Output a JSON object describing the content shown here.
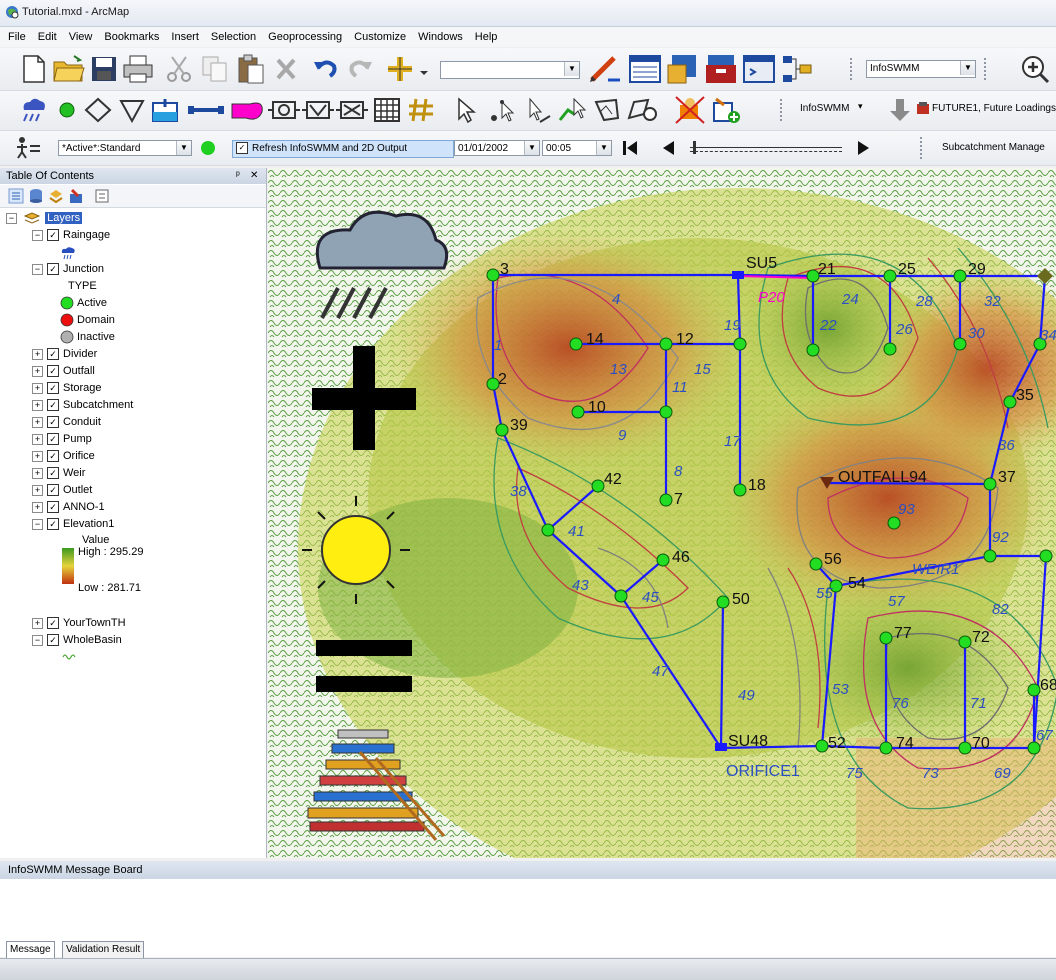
{
  "window": {
    "title": "Tutorial.mxd - ArcMap"
  },
  "menu": [
    "File",
    "Edit",
    "View",
    "Bookmarks",
    "Insert",
    "Selection",
    "Geoprocessing",
    "Customize",
    "Windows",
    "Help"
  ],
  "toolbar1": {
    "scale_combo": "",
    "infoswmm_combo": "InfoSWMM"
  },
  "toolbar2": {
    "infoswmm_menu": "InfoSWMM",
    "scenario": "FUTURE1, Future Loadings"
  },
  "toolbar3": {
    "scenario_select": "*Active*:Standard",
    "refresh_label": "Refresh InfoSWMM and 2D Output",
    "date": "01/01/2002",
    "time": "00:05",
    "subcatchment_btn": "Subcatchment Manage"
  },
  "toc": {
    "title": "Table Of Contents",
    "close": "✕",
    "pin": "ᵖ",
    "layers_root": "Layers",
    "items": [
      {
        "label": "Raingage"
      },
      {
        "label": "Junction"
      },
      {
        "label": "TYPE"
      },
      {
        "label": "Active"
      },
      {
        "label": "Domain"
      },
      {
        "label": "Inactive"
      },
      {
        "label": "Divider"
      },
      {
        "label": "Outfall"
      },
      {
        "label": "Storage"
      },
      {
        "label": "Subcatchment"
      },
      {
        "label": "Conduit"
      },
      {
        "label": "Pump"
      },
      {
        "label": "Orifice"
      },
      {
        "label": "Weir"
      },
      {
        "label": "Outlet"
      },
      {
        "label": "ANNO-1"
      },
      {
        "label": "Elevation1"
      },
      {
        "label": "Value"
      },
      {
        "label": "High : 295.29"
      },
      {
        "label": "Low : 281.71"
      },
      {
        "label": "YourTownTH"
      },
      {
        "label": "WholeBasin"
      }
    ],
    "colors": {
      "active": "#00e000",
      "domain": "#e00000",
      "inactive": "#a0a0a0",
      "elev_high": "#3a9a20",
      "elev_low": "#c03010"
    }
  },
  "map": {
    "node_labels": [
      "3",
      "SU5",
      "21",
      "25",
      "29",
      "14",
      "12",
      "2",
      "35",
      "10",
      "39",
      "OUTFALL94",
      "37",
      "42",
      "18",
      "7",
      "46",
      "56",
      "54",
      "50",
      "77",
      "72",
      "68",
      "SU48",
      "52",
      "74",
      "70",
      "ORIFICE1"
    ],
    "link_labels": [
      "4",
      "P20",
      "24",
      "28",
      "32",
      "30",
      "22",
      "26",
      "34",
      "13",
      "15",
      "19",
      "1",
      "11",
      "9",
      "17",
      "36",
      "8",
      "93",
      "92",
      "WEIR1",
      "41",
      "38",
      "45",
      "43",
      "55",
      "57",
      "82",
      "47",
      "49",
      "53",
      "76",
      "71",
      "67",
      "75",
      "73",
      "69"
    ],
    "colors": {
      "pipe": "#1a1aff",
      "node": "#22dd22",
      "label_blue": "#2b4fc2",
      "outfall": "#6b2a10"
    }
  },
  "message_board": {
    "title": "InfoSWMM Message Board",
    "tabs": [
      "Message",
      "Validation Result"
    ]
  }
}
